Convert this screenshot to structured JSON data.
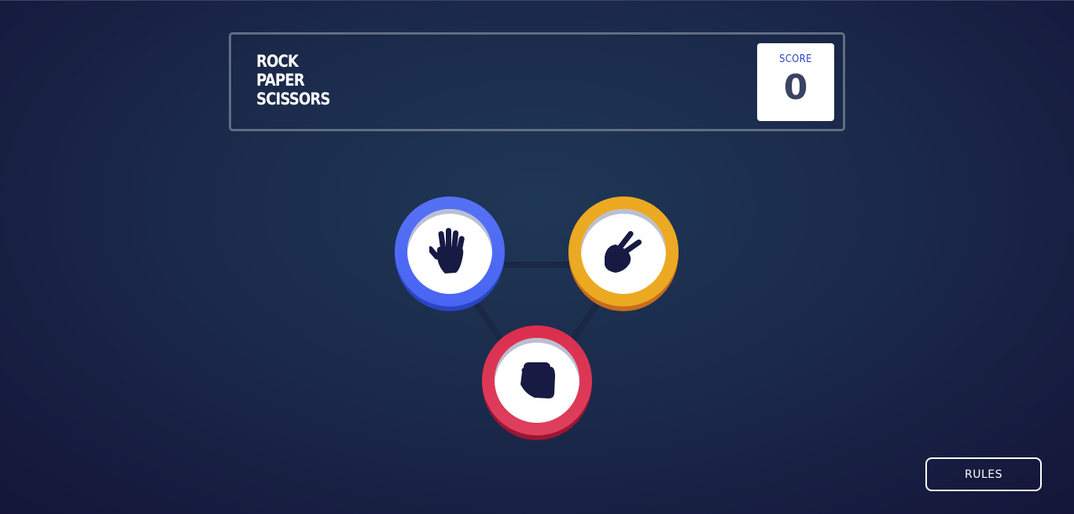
{
  "header": {
    "title_lines": [
      "ROCK",
      "PAPER",
      "SCISSORS"
    ],
    "score_label": "SCORE",
    "score_value": "0"
  },
  "choices": [
    {
      "id": "paper",
      "icon": "paper-hand-icon",
      "color": "#4865f4"
    },
    {
      "id": "scissors",
      "icon": "scissors-hand-icon",
      "color": "#eca922"
    },
    {
      "id": "rock",
      "icon": "rock-fist-icon",
      "color": "#dc2e4e"
    }
  ],
  "rules_button": "RULES"
}
